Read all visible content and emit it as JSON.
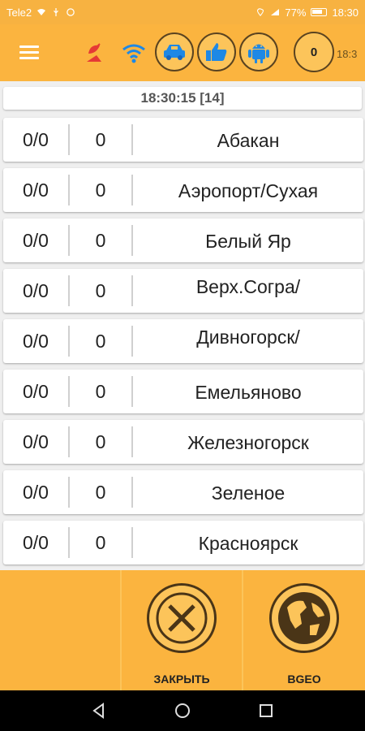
{
  "status_bar": {
    "carrier": "Tele2",
    "battery": "77%",
    "time": "18:30"
  },
  "app_bar": {
    "counter": "0",
    "time_truncated": "18:3"
  },
  "timer": "18:30:15 [14]",
  "rows": [
    {
      "ratio": "0/0",
      "count": "0",
      "name": "Абакан"
    },
    {
      "ratio": "0/0",
      "count": "0",
      "name": "Аэропорт/Сухая"
    },
    {
      "ratio": "0/0",
      "count": "0",
      "name": "Белый Яр"
    },
    {
      "ratio": "0/0",
      "count": "0",
      "name": "Верх.Сограǀ",
      "name_full": "Верх.Согра/"
    },
    {
      "ratio": "0/0",
      "count": "0",
      "name": "Дивногорск/"
    },
    {
      "ratio": "0/0",
      "count": "0",
      "name": "Емельяново"
    },
    {
      "ratio": "0/0",
      "count": "0",
      "name": "Железногорск"
    },
    {
      "ratio": "0/0",
      "count": "0",
      "name": "Зеленое"
    },
    {
      "ratio": "0/0",
      "count": "0",
      "name": "Красноярск"
    }
  ],
  "actions": {
    "close_label": "ЗАКРЫТЬ",
    "bgeo_label": "BGEO"
  },
  "colors": {
    "appbar": "#fbb43f",
    "accent_dark": "#4a3517",
    "icon_blue": "#1e88e5",
    "icon_red": "#e53935"
  }
}
